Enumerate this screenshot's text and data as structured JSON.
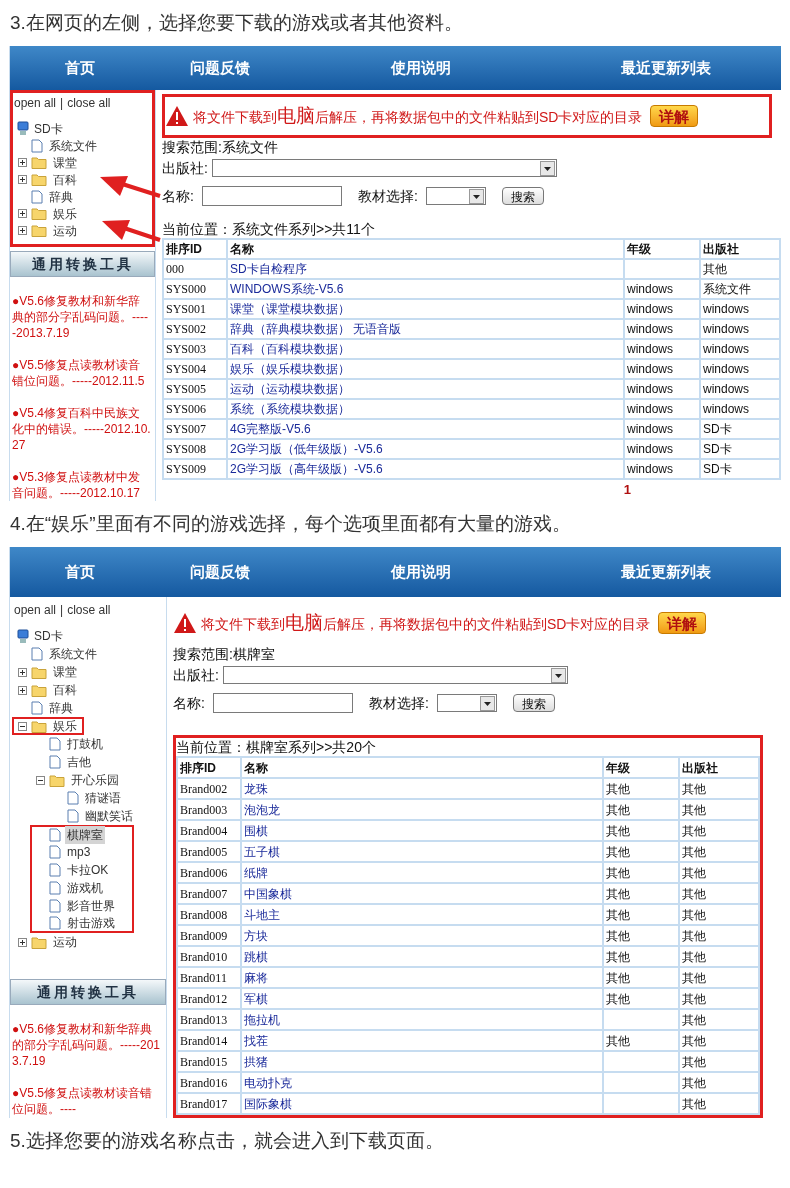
{
  "steps": [
    {
      "caption": "3.在网页的左侧，选择您要下载的游戏或者其他资料。",
      "screen": {
        "nav": [
          "首页",
          "问题反馈",
          "使用说明",
          "最近更新列表"
        ],
        "open_all": "open all",
        "separator": "|",
        "close_all": "close all",
        "tree_box": true,
        "arrows": true,
        "tree": {
          "label": "SD卡",
          "kind": "root",
          "selected": false,
          "children": [
            {
              "label": "系统文件",
              "kind": "file",
              "selected": false,
              "highlighted": false
            },
            {
              "label": "课堂",
              "kind": "folder",
              "expanded": false,
              "selected": false,
              "highlighted": false
            },
            {
              "label": "百科",
              "kind": "folder",
              "expanded": false,
              "selected": false,
              "highlighted": false
            },
            {
              "label": "辞典",
              "kind": "file",
              "selected": false,
              "highlighted": false
            },
            {
              "label": "娱乐",
              "kind": "folder",
              "expanded": false,
              "selected": false,
              "highlighted": false
            },
            {
              "label": "运动",
              "kind": "folder",
              "expanded": false,
              "selected": false,
              "highlighted": false
            }
          ]
        },
        "tool_button": "通用转换工具",
        "news": [
          "●V5.6修复教材和新华辞典的部分字乱码问题。-----2013.7.19",
          "●V5.5修复点读教材读音错位问题。-----2012.11.5",
          "●V5.4修复百科中民族文化中的错误。-----2012.10.27",
          "●V5.3修复点读教材中发音问题。-----2012.10.17"
        ],
        "notice": {
          "before": "将文件下载到",
          "emphasis": "电脑",
          "after": "后解压，再将数据包中的文件粘贴到SD卡对应的目录",
          "button": "详解",
          "boxed": true
        },
        "scope": "搜索范围:系统文件",
        "publisher_label": "出版社:",
        "name_label": "名称:",
        "textbook_label": "教材选择:",
        "search_button": "搜索",
        "location": "当前位置：系统文件系列>>共11个",
        "columns": [
          "排序ID",
          "名称",
          "年级",
          "出版社"
        ],
        "rows": [
          {
            "id": "000",
            "name": "SD卡自检程序",
            "publisher": "其他"
          },
          {
            "id": "SYS000",
            "name": "WINDOWS系统-V5.6",
            "grade": "windows",
            "publisher": "系统文件"
          },
          {
            "id": "SYS001",
            "name": "课堂（课堂模块数据）",
            "grade": "windows",
            "publisher": "windows"
          },
          {
            "id": "SYS002",
            "name": "辞典（辞典模块数据） 无语音版",
            "grade": "windows",
            "publisher": "windows"
          },
          {
            "id": "SYS003",
            "name": "百科（百科模块数据）",
            "grade": "windows",
            "publisher": "windows"
          },
          {
            "id": "SYS004",
            "name": "娱乐（娱乐模块数据）",
            "grade": "windows",
            "publisher": "windows"
          },
          {
            "id": "SYS005",
            "name": "运动（运动模块数据）",
            "grade": "windows",
            "publisher": "windows"
          },
          {
            "id": "SYS006",
            "name": "系统（系统模块数据）",
            "grade": "windows",
            "publisher": "windows"
          },
          {
            "id": "SYS007",
            "name": "4G完整版-V5.6",
            "grade": "windows",
            "publisher": "SD卡"
          },
          {
            "id": "SYS008",
            "name": "2G学习版（低年级版）-V5.6",
            "grade": "windows",
            "publisher": "SD卡"
          },
          {
            "id": "SYS009",
            "name": "2G学习版（高年级版）-V5.6",
            "grade": "windows",
            "publisher": "SD卡"
          }
        ],
        "page": "1"
      }
    },
    {
      "caption": "4.在“娱乐”里面有不同的游戏选择，每个选项里面都有大量的游戏。",
      "screen": {
        "nav": [
          "首页",
          "问题反馈",
          "使用说明",
          "最近更新列表"
        ],
        "open_all": "open all",
        "separator": "|",
        "close_all": "close all",
        "tree": {
          "label": "SD卡",
          "kind": "root",
          "selected": false,
          "children": [
            {
              "label": "系统文件",
              "kind": "file",
              "selected": false,
              "highlighted": false
            },
            {
              "label": "课堂",
              "kind": "folder",
              "expanded": false,
              "selected": false,
              "highlighted": false
            },
            {
              "label": "百科",
              "kind": "folder",
              "expanded": false,
              "selected": false,
              "highlighted": false
            },
            {
              "label": "辞典",
              "kind": "file",
              "selected": false,
              "highlighted": false
            },
            {
              "label": "娱乐",
              "kind": "folder",
              "expanded": true,
              "selected": false,
              "highlighted": true,
              "children": [
                {
                  "label": "打鼓机",
                  "kind": "file",
                  "selected": false,
                  "highlighted": false
                },
                {
                  "label": "吉他",
                  "kind": "file",
                  "selected": false,
                  "highlighted": false
                },
                {
                  "label": "开心乐园",
                  "kind": "folder",
                  "expanded": true,
                  "selected": false,
                  "highlighted": false,
                  "children": [
                    {
                      "label": "猜谜语",
                      "kind": "file",
                      "selected": false,
                      "highlighted": false
                    },
                    {
                      "label": "幽默笑话",
                      "kind": "file",
                      "selected": false,
                      "highlighted": false
                    }
                  ]
                },
                {
                  "label": "棋牌室",
                  "kind": "file",
                  "selected": true,
                  "highlighted": true
                },
                {
                  "label": "mp3",
                  "kind": "file",
                  "selected": false,
                  "highlighted": true
                },
                {
                  "label": "卡拉OK",
                  "kind": "file",
                  "selected": false,
                  "highlighted": true
                },
                {
                  "label": "游戏机",
                  "kind": "file",
                  "selected": false,
                  "highlighted": true
                },
                {
                  "label": "影音世界",
                  "kind": "file",
                  "selected": false,
                  "highlighted": true
                },
                {
                  "label": "射击游戏",
                  "kind": "file",
                  "selected": false,
                  "highlighted": true
                }
              ]
            },
            {
              "label": "运动",
              "kind": "folder",
              "expanded": false,
              "selected": false,
              "highlighted": false
            }
          ]
        },
        "tool_button": "通用转换工具",
        "news": [
          "●V5.6修复教材和新华辞典的部分字乱码问题。-----2013.7.19",
          "●V5.5修复点读教材读音错位问题。----"
        ],
        "notice": {
          "before": "将文件下载到",
          "emphasis": "电脑",
          "after": "后解压，再将数据包中的文件粘贴到SD卡对应的目录",
          "button": "详解"
        },
        "scope": "搜索范围:棋牌室",
        "publisher_label": "出版社:",
        "name_label": "名称:",
        "textbook_label": "教材选择:",
        "search_button": "搜索",
        "location": "当前位置：棋牌室系列>>共20个",
        "table_box": true,
        "columns": [
          "排序ID",
          "名称",
          "年级",
          "出版社"
        ],
        "rows": [
          {
            "id": "Brand002",
            "name": "龙珠",
            "grade": "其他",
            "publisher": "其他"
          },
          {
            "id": "Brand003",
            "name": "泡泡龙",
            "grade": "其他",
            "publisher": "其他"
          },
          {
            "id": "Brand004",
            "name": "围棋",
            "grade": "其他",
            "publisher": "其他"
          },
          {
            "id": "Brand005",
            "name": "五子棋",
            "grade": "其他",
            "publisher": "其他"
          },
          {
            "id": "Brand006",
            "name": "纸牌",
            "grade": "其他",
            "publisher": "其他"
          },
          {
            "id": "Brand007",
            "name": "中国象棋",
            "grade": "其他",
            "publisher": "其他"
          },
          {
            "id": "Brand008",
            "name": "斗地主",
            "grade": "其他",
            "publisher": "其他"
          },
          {
            "id": "Brand009",
            "name": "方块",
            "grade": "其他",
            "publisher": "其他"
          },
          {
            "id": "Brand010",
            "name": "跳棋",
            "grade": "其他",
            "publisher": "其他"
          },
          {
            "id": "Brand011",
            "name": "麻将",
            "grade": "其他",
            "publisher": "其他"
          },
          {
            "id": "Brand012",
            "name": "军棋",
            "grade": "其他",
            "publisher": "其他"
          },
          {
            "id": "Brand013",
            "name": "拖拉机",
            "publisher": "其他"
          },
          {
            "id": "Brand014",
            "name": "找茬",
            "grade": "其他",
            "publisher": "其他"
          },
          {
            "id": "Brand015",
            "name": "拱猪",
            "publisher": "其他"
          },
          {
            "id": "Brand016",
            "name": "电动扑克",
            "publisher": "其他"
          },
          {
            "id": "Brand017",
            "name": "国际象棋",
            "publisher": "其他"
          }
        ]
      }
    }
  ],
  "footer_caption": "5.选择您要的游戏名称点击，就会进入到下载页面。"
}
